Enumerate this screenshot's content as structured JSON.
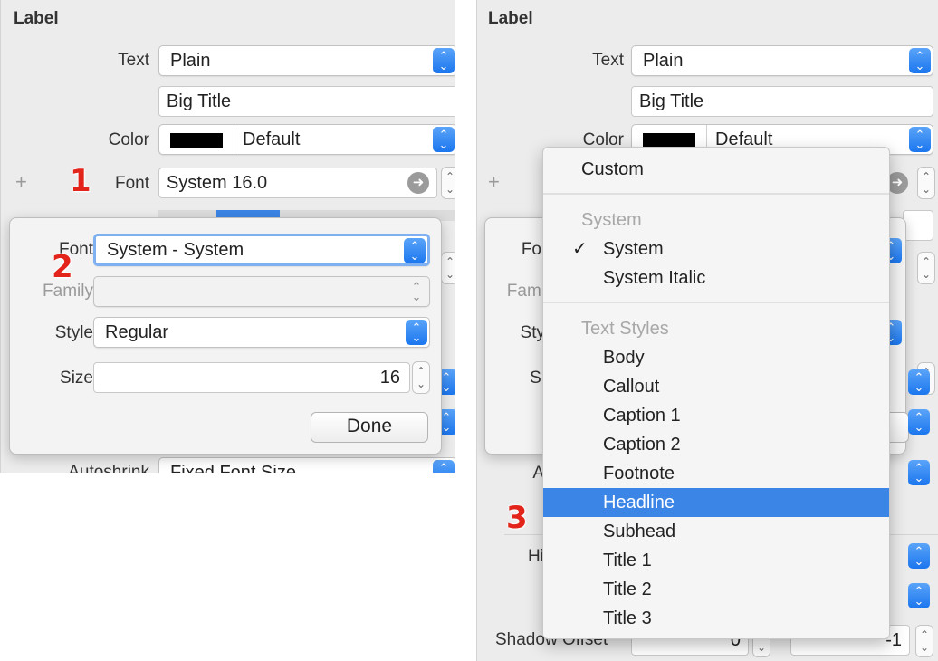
{
  "left": {
    "section_title": "Label",
    "text_label": "Text",
    "text_value": "Plain",
    "title_value": "Big Title",
    "color_label": "Color",
    "color_value": "Default",
    "font_label": "Font",
    "font_value": "System 16.0",
    "autoshrink_label": "Autoshrink",
    "autoshrink_value": "Fixed Font Size",
    "badge_1": "1",
    "badge_2": "2"
  },
  "popover": {
    "font_label": "Font",
    "font_value": "System - System",
    "family_label": "Family",
    "family_value": "",
    "style_label": "Style",
    "style_value": "Regular",
    "size_label": "Size",
    "size_value": "16",
    "done_label": "Done"
  },
  "right": {
    "section_title": "Label",
    "text_label": "Text",
    "text_value": "Plain",
    "title_value": "Big Title",
    "color_label": "Color",
    "color_value": "Default",
    "shadow_offset_label": "Shadow Offset",
    "shadow_offset_h": "0",
    "shadow_offset_v": "-1",
    "badge_3": "3",
    "partial_font_label": "Fo",
    "partial_family_label": "Fami",
    "partial_style_label": "Sty",
    "partial_size_label": "Si",
    "partial_autoshrink_label": "A",
    "partial_highlighted_label": "Hi"
  },
  "menu": {
    "custom": "Custom",
    "system_header": "System",
    "checkmark": "✓",
    "system_items": [
      "System",
      "System Italic"
    ],
    "text_styles_header": "Text Styles",
    "text_style_items": [
      "Body",
      "Callout",
      "Caption 1",
      "Caption 2",
      "Footnote",
      "Headline",
      "Subhead",
      "Title 1",
      "Title 2",
      "Title 3"
    ],
    "selected": "Headline"
  },
  "colors": {
    "accent": "#3b85e6",
    "badge": "#e3241b",
    "panel_bg": "#ececec"
  }
}
